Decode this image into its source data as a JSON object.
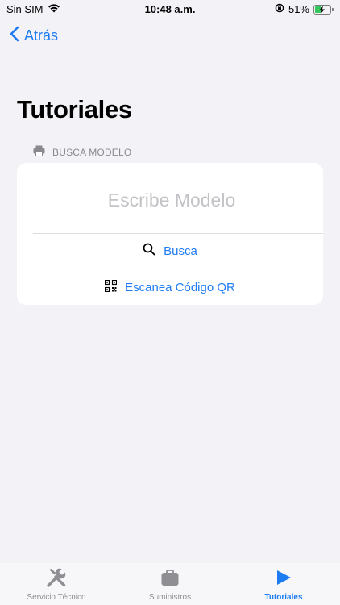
{
  "status_bar": {
    "carrier": "Sin SIM",
    "time": "10:48 a.m.",
    "battery_percent": "51%",
    "battery_level": 0.51,
    "icons": [
      "wifi-icon",
      "orientation-lock-icon",
      "battery-charging-icon"
    ]
  },
  "nav": {
    "back_label": "Atrás"
  },
  "page": {
    "title": "Tutoriales"
  },
  "search_section": {
    "header": "BUSCA MODELO",
    "header_icon": "printer-icon",
    "input_placeholder": "Escribe Modelo",
    "input_value": "",
    "search_label": "Busca",
    "search_icon": "magnifier-icon",
    "qr_label": "Escanea Código QR",
    "qr_icon": "qr-code-icon"
  },
  "tab_bar": {
    "tabs": [
      {
        "label": "Servicio Técnico",
        "icon": "wrench-screwdriver-icon",
        "active": false
      },
      {
        "label": "Suministros",
        "icon": "briefcase-icon",
        "active": false
      },
      {
        "label": "Tutoriales",
        "icon": "play-icon",
        "active": true
      }
    ]
  },
  "colors": {
    "accent": "#1e7cf2",
    "background": "#f2f2f7",
    "inactive_tab": "#8e8e93",
    "battery": "#34c759"
  }
}
